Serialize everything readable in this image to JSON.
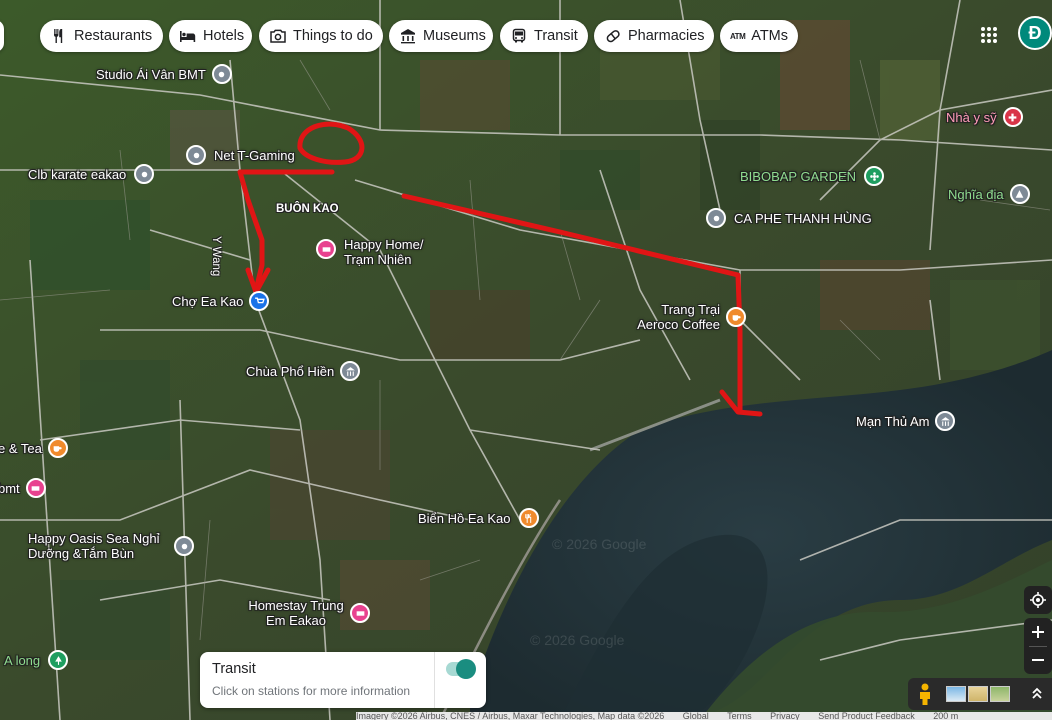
{
  "categories": [
    {
      "label": "Restaurants",
      "icon": "fork-knife-icon"
    },
    {
      "label": "Hotels",
      "icon": "bed-icon"
    },
    {
      "label": "Things to do",
      "icon": "camera-icon"
    },
    {
      "label": "Museums",
      "icon": "museum-icon"
    },
    {
      "label": "Transit",
      "icon": "bus-icon"
    },
    {
      "label": "Pharmacies",
      "icon": "pill-icon"
    },
    {
      "label": "ATMs",
      "icon": "atm-icon"
    }
  ],
  "atm_glyph": "ATM",
  "avatar_letter": "Đ",
  "places": {
    "studio_ai_van": "Studio Ái Vân BMT",
    "net_t_gaming": "Net T-Gaming",
    "clb_karate": "Clb karate eakao",
    "buon_kao": "BUÔN KAO",
    "happy_home": "Happy Home/ Trạm Nhiên",
    "y_wang": "Y Wang",
    "cho_ea_kao": "Chợ Ea Kao",
    "chua_pho_hien": "Chùa Phổ Hiền",
    "e_tea": "e & Tea",
    "bmt": "bmt",
    "happy_oasis": "Happy Oasis Sea Nghỉ Dưỡng &Tắm Bùn",
    "bien_ho": "Biển Hồ Ea Kao",
    "homestay_trung": "Homestay Trung Em Eakao",
    "a_long": "A long",
    "bibobap": "BIBOBAP GARDEN",
    "ca_phe_thanh_hung": "CA PHE THANH HÙNG",
    "nha_y_sy": "Nhà y sỹ",
    "nghia_dia": "Nghĩa địa",
    "trang_trai": "Trang Trại Aeroco Coffee",
    "man_thu_am": "Mạn Thủ Am"
  },
  "transit": {
    "title": "Transit",
    "subtitle": "Click on stations for more information",
    "enabled": true
  },
  "watermark": "© 2026 Google",
  "footer": {
    "imagery": "Imagery ©2026 Airbus, CNES / Airbus, Maxar Technologies, Map data ©2026",
    "links": [
      "Global",
      "Terms",
      "Privacy",
      "Send Product Feedback"
    ],
    "scale": "200 m"
  },
  "colors": {
    "route_annotation": "#e01515",
    "transit_toggle": "#1a8d80",
    "avatar_bg": "#00897b"
  }
}
